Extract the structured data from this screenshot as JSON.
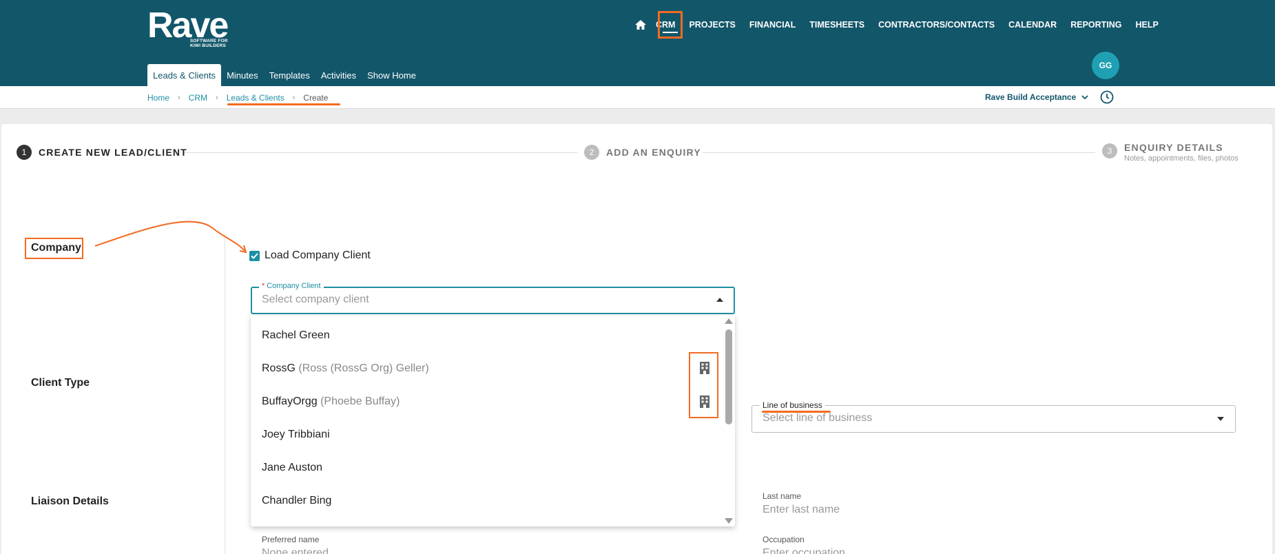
{
  "brand": {
    "logo_text": "Rave",
    "logo_subtext": "SOFTWARE FOR KIWI BUILDERS",
    "header_color": "#12566a",
    "accent_color": "#1e8ea3",
    "highlight_color": "#f36b21"
  },
  "main_nav": {
    "items": [
      "CRM",
      "PROJECTS",
      "FINANCIAL",
      "TIMESHEETS",
      "CONTRACTORS/CONTACTS",
      "CALENDAR",
      "REPORTING",
      "HELP"
    ],
    "active": "CRM"
  },
  "user": {
    "initials": "GG"
  },
  "sub_nav": {
    "items": [
      "Leads & Clients",
      "Minutes",
      "Templates",
      "Activities",
      "Show Home"
    ],
    "active": "Leads & Clients"
  },
  "breadcrumb": {
    "items": [
      "Home",
      "CRM",
      "Leads & Clients",
      "Create"
    ]
  },
  "org_selector": {
    "label": "Rave Build Acceptance"
  },
  "stepper": {
    "steps": [
      {
        "num": "1",
        "label": "CREATE NEW LEAD/CLIENT"
      },
      {
        "num": "2",
        "label": "ADD AN ENQUIRY"
      },
      {
        "num": "3",
        "label": "ENQUIRY DETAILS",
        "desc": "Notes, appointments, files, photos"
      }
    ]
  },
  "sections": {
    "company": "Company",
    "client_type": "Client Type",
    "liaison": "Liaison Details"
  },
  "company_form": {
    "load_checkbox_label": "Load Company Client",
    "load_checked": true,
    "company_client_label": "Company Client",
    "company_client_required": "*",
    "company_client_placeholder": "Select company client"
  },
  "dropdown_options": [
    {
      "name": "Rachel Green",
      "sub": "",
      "company": false
    },
    {
      "name": "RossG",
      "sub": "(Ross (RossG Org) Geller)",
      "company": true
    },
    {
      "name": "BuffayOrgg",
      "sub": "(Phoebe Buffay)",
      "company": true
    },
    {
      "name": "Joey Tribbiani",
      "sub": "",
      "company": false
    },
    {
      "name": "Jane Auston",
      "sub": "",
      "company": false
    },
    {
      "name": "Chandler Bing",
      "sub": "",
      "company": false
    }
  ],
  "line_of_business": {
    "label": "Line of business",
    "placeholder": "Select line of business"
  },
  "liaison_fields": {
    "last_name_label": "Last name",
    "last_name_placeholder": "Enter last name",
    "preferred_name_label": "Preferred name",
    "preferred_name_value": "None entered",
    "occupation_label": "Occupation",
    "occupation_placeholder": "Enter occupation"
  },
  "icons": {
    "home": "home-icon",
    "building": "building-icon",
    "clock": "clock-icon",
    "chevron": "chevron-down-icon",
    "check": "check-icon"
  }
}
